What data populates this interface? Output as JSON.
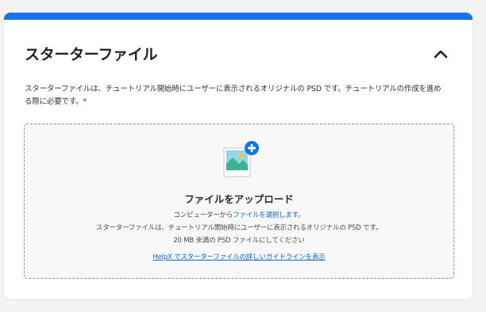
{
  "colors": {
    "accent": "#1473e6",
    "link": "#0d66d0",
    "dropzone_bg": "#f8f8f8",
    "dropzone_border": "#8e8e8e"
  },
  "section": {
    "title": "スターターファイル",
    "collapse_icon": "chevron-up-icon",
    "description": "スターターファイルは、チュートリアル開始時にユーザーに表示されるオリジナルの PSD です。チュートリアルの作成を進める際に必要です。*"
  },
  "upload": {
    "icon": "image-add-icon",
    "heading": "ファイルをアップロード",
    "from_computer_prefix": "コンピューターから",
    "select_file_link": "ファイルを選択します",
    "from_computer_suffix": "。",
    "info_line": "スターターファイルは、チュートリアル開始時にユーザーに表示されるオリジナルの PSD です。",
    "size_line": "20 MB 未満の PSD ファイルにしてください",
    "guideline_link": "HelpX でスターターファイルの詳しいガイドラインを表示"
  }
}
